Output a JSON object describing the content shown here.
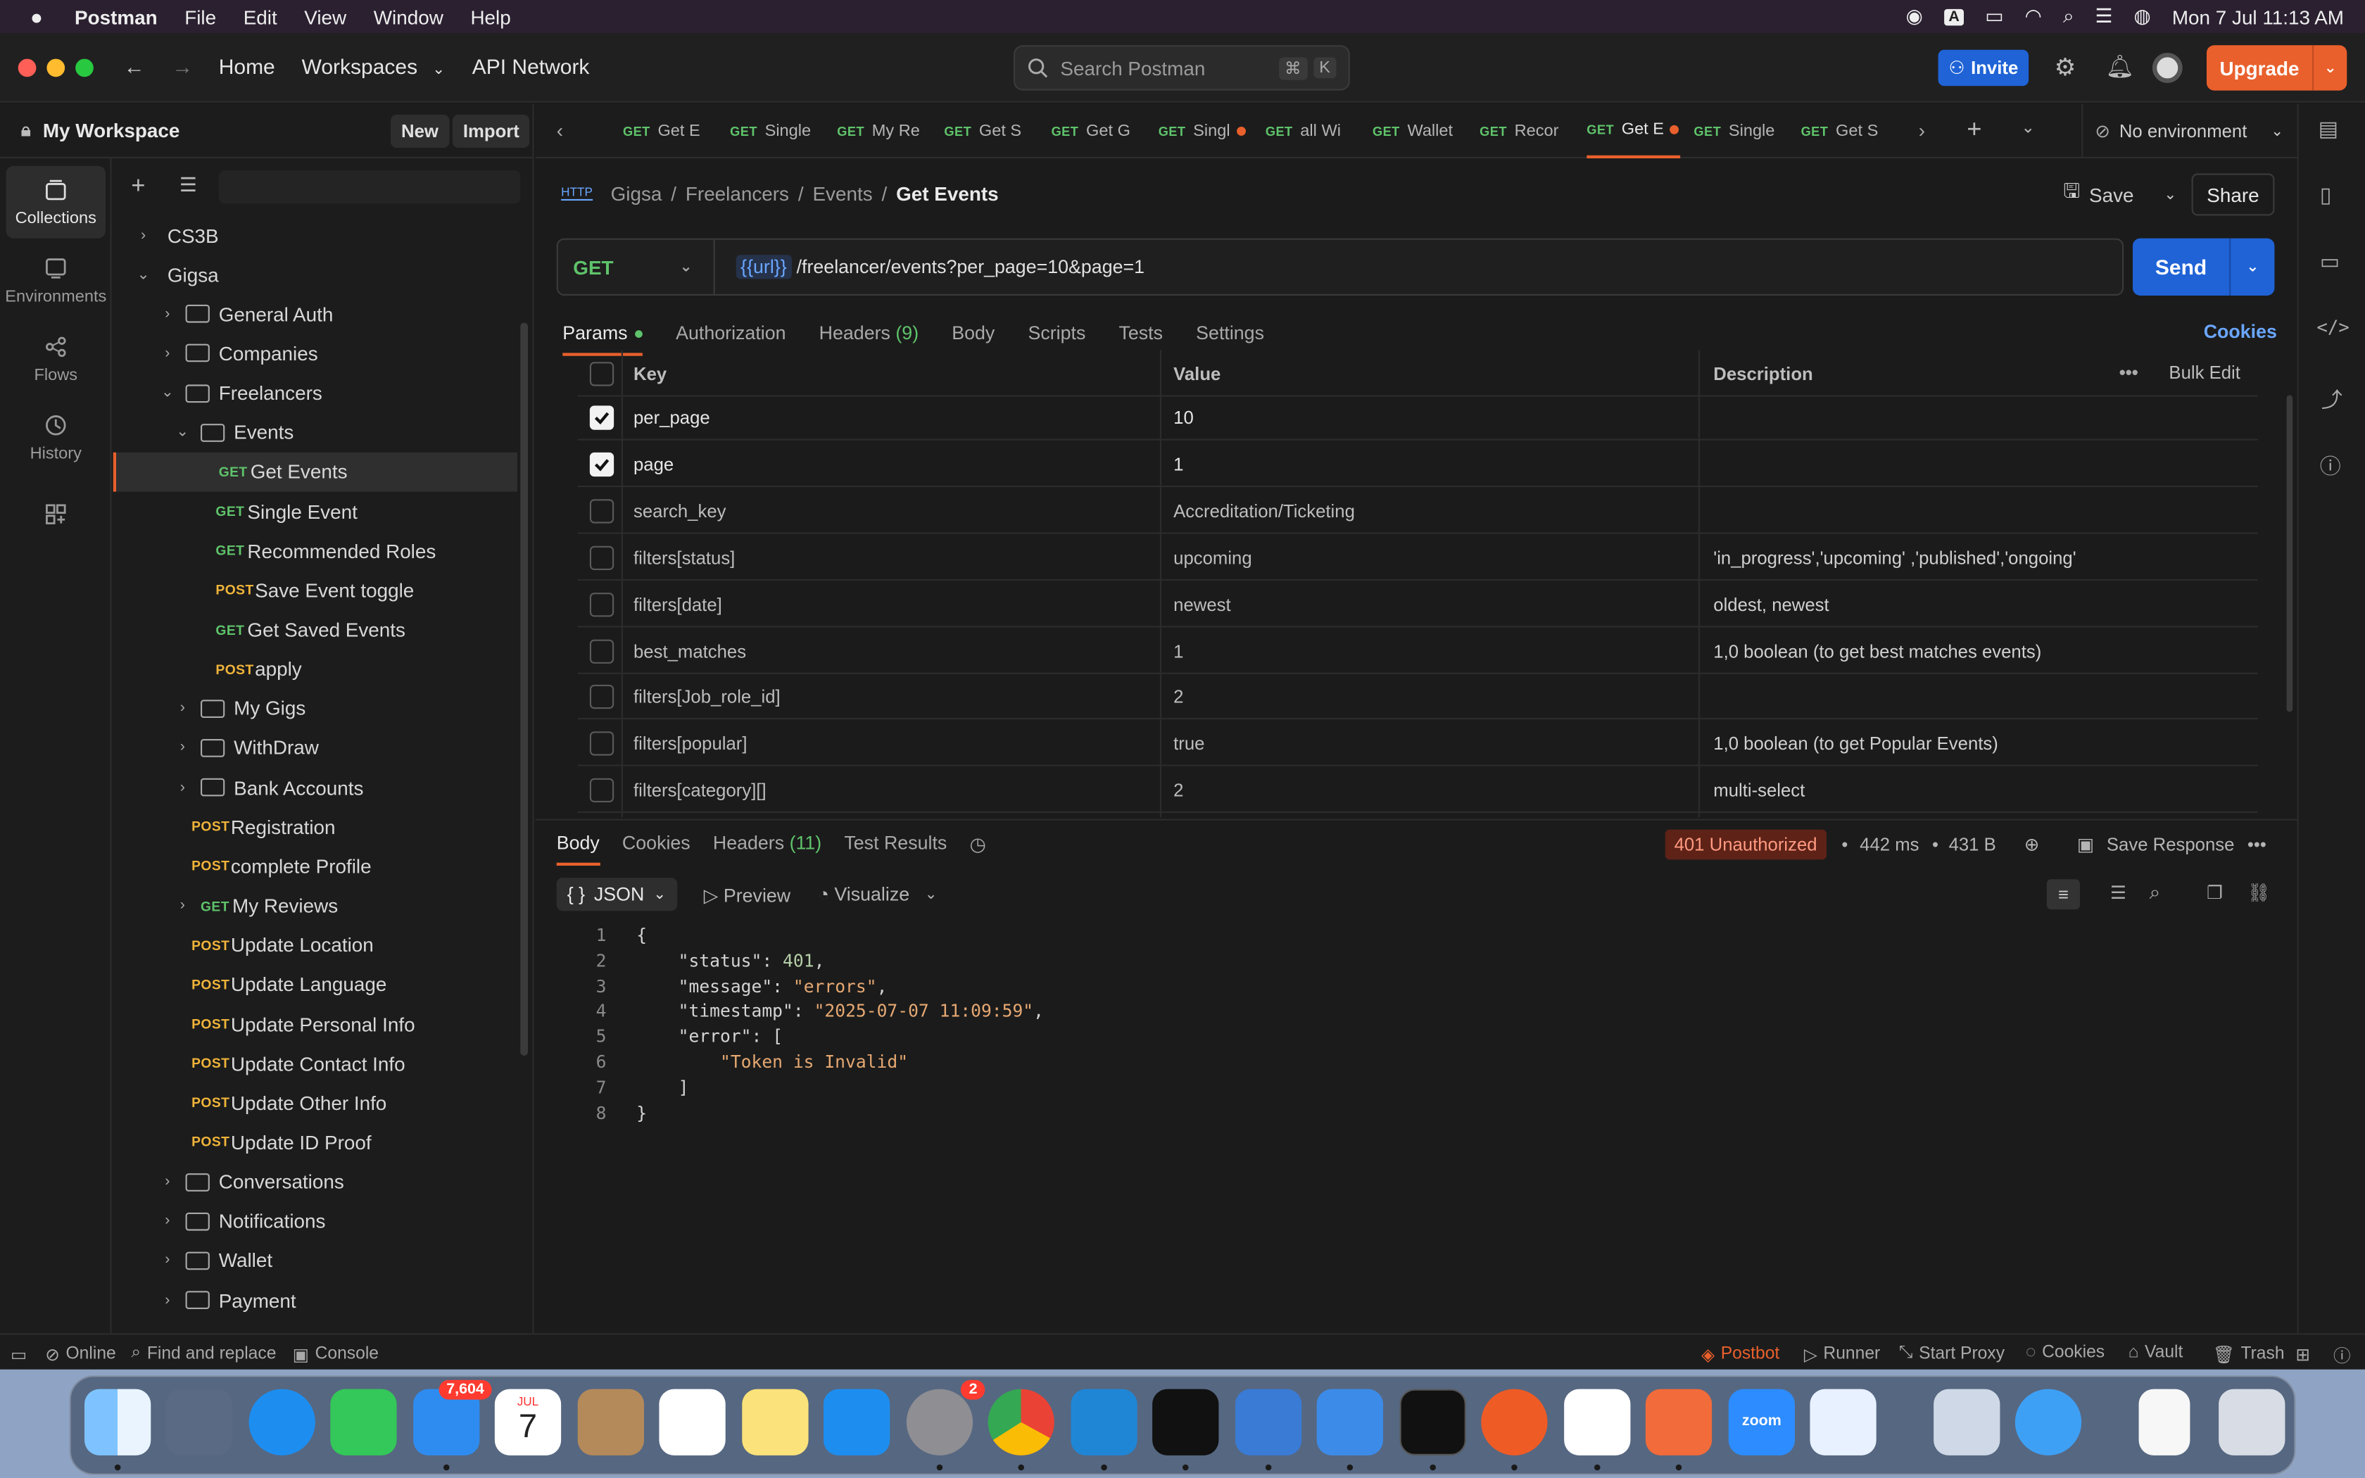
{
  "menubar": {
    "app": "Postman",
    "items": [
      "File",
      "Edit",
      "View",
      "Window",
      "Help"
    ],
    "clock": "Mon 7 Jul  11:13 AM"
  },
  "titlebar": {
    "home": "Home",
    "workspaces": "Workspaces",
    "api_network": "API Network",
    "search_placeholder": "Search Postman",
    "search_kbd_1": "⌘",
    "search_kbd_2": "K",
    "invite": "Invite",
    "upgrade": "Upgrade"
  },
  "workspace": {
    "name": "My Workspace",
    "new_label": "New",
    "import_label": "Import"
  },
  "rail": {
    "collections": "Collections",
    "environments": "Environments",
    "flows": "Flows",
    "history": "History"
  },
  "tree": [
    {
      "level": 0,
      "type": "collection",
      "label": "CS3B",
      "open": false
    },
    {
      "level": 0,
      "type": "collection",
      "label": "Gigsa",
      "open": true
    },
    {
      "level": 1,
      "type": "folder",
      "label": "General Auth",
      "open": false
    },
    {
      "level": 1,
      "type": "folder",
      "label": "Companies",
      "open": false
    },
    {
      "level": 1,
      "type": "folder",
      "label": "Freelancers",
      "open": true
    },
    {
      "level": 2,
      "type": "folder",
      "label": "Events",
      "open": true
    },
    {
      "level": 3,
      "type": "request",
      "method": "GET",
      "label": "Get Events",
      "selected": true
    },
    {
      "level": 3,
      "type": "request",
      "method": "GET",
      "label": "Single Event"
    },
    {
      "level": 3,
      "type": "request",
      "method": "GET",
      "label": "Recommended Roles"
    },
    {
      "level": 3,
      "type": "request",
      "method": "POST",
      "label": "Save Event toggle"
    },
    {
      "level": 3,
      "type": "request",
      "method": "GET",
      "label": "Get Saved Events"
    },
    {
      "level": 3,
      "type": "request",
      "method": "POST",
      "label": "apply"
    },
    {
      "level": 2,
      "type": "folder",
      "label": "My Gigs",
      "open": false
    },
    {
      "level": 2,
      "type": "folder",
      "label": "WithDraw",
      "open": false
    },
    {
      "level": 2,
      "type": "folder",
      "label": "Bank Accounts",
      "open": false
    },
    {
      "level": 2,
      "type": "request",
      "method": "POST",
      "label": "Registration"
    },
    {
      "level": 2,
      "type": "request",
      "method": "POST",
      "label": "complete Profile"
    },
    {
      "level": 2,
      "type": "reqfolder",
      "method": "GET",
      "label": "My Reviews"
    },
    {
      "level": 2,
      "type": "request",
      "method": "POST",
      "label": "Update Location"
    },
    {
      "level": 2,
      "type": "request",
      "method": "POST",
      "label": "Update Language"
    },
    {
      "level": 2,
      "type": "request",
      "method": "POST",
      "label": "Update Personal Info"
    },
    {
      "level": 2,
      "type": "request",
      "method": "POST",
      "label": "Update Contact Info"
    },
    {
      "level": 2,
      "type": "request",
      "method": "POST",
      "label": "Update Other Info"
    },
    {
      "level": 2,
      "type": "request",
      "method": "POST",
      "label": "Update ID Proof"
    },
    {
      "level": 1,
      "type": "folder",
      "label": "Conversations",
      "open": false
    },
    {
      "level": 1,
      "type": "folder",
      "label": "Notifications",
      "open": false
    },
    {
      "level": 1,
      "type": "folder",
      "label": "Wallet",
      "open": false
    },
    {
      "level": 1,
      "type": "folder",
      "label": "Payment",
      "open": false
    }
  ],
  "tabs": [
    {
      "method": "GET",
      "label": "Get E"
    },
    {
      "method": "GET",
      "label": "Single"
    },
    {
      "method": "GET",
      "label": "My Re"
    },
    {
      "method": "GET",
      "label": "Get S"
    },
    {
      "method": "GET",
      "label": "Get G"
    },
    {
      "method": "GET",
      "label": "Singl",
      "dot": true
    },
    {
      "method": "GET",
      "label": "all Wi"
    },
    {
      "method": "GET",
      "label": "Wallet"
    },
    {
      "method": "GET",
      "label": "Recor"
    },
    {
      "method": "GET",
      "label": "Get E",
      "dot": true,
      "active": true
    },
    {
      "method": "GET",
      "label": "Single"
    },
    {
      "method": "GET",
      "label": "Get S"
    }
  ],
  "environment": "No environment",
  "request": {
    "breadcrumb": [
      "Gigsa",
      "Freelancers",
      "Events"
    ],
    "name": "Get Events",
    "http_badge": "HTTP",
    "save": "Save",
    "share": "Share",
    "method": "GET",
    "url_var": "{{url}}",
    "url_path": "/freelancer/events?per_page=10&page=1",
    "send": "Send",
    "tabs": {
      "params": "Params",
      "authorization": "Authorization",
      "headers": "Headers",
      "headers_count": "(9)",
      "body": "Body",
      "scripts": "Scripts",
      "tests": "Tests",
      "settings": "Settings"
    },
    "cookies": "Cookies"
  },
  "params": {
    "headers": {
      "key": "Key",
      "value": "Value",
      "description": "Description",
      "bulk_edit": "Bulk Edit"
    },
    "rows": [
      {
        "checked": true,
        "key": "per_page",
        "value": "10",
        "description": ""
      },
      {
        "checked": true,
        "key": "page",
        "value": "1",
        "description": ""
      },
      {
        "checked": false,
        "key": "search_key",
        "value": "Accreditation/Ticketing",
        "description": ""
      },
      {
        "checked": false,
        "key": "filters[status]",
        "value": "upcoming",
        "description": "'in_progress','upcoming' ,'published','ongoing'"
      },
      {
        "checked": false,
        "key": "filters[date]",
        "value": "newest",
        "description": "oldest, newest"
      },
      {
        "checked": false,
        "key": "best_matches",
        "value": "1",
        "description": "1,0 boolean (to get best matches events)"
      },
      {
        "checked": false,
        "key": "filters[Job_role_id]",
        "value": "2",
        "description": ""
      },
      {
        "checked": false,
        "key": "filters[popular]",
        "value": "true",
        "description": "1,0 boolean (to get Popular Events)"
      },
      {
        "checked": false,
        "key": "filters[category][]",
        "value": "2",
        "description": "multi-select"
      }
    ]
  },
  "response": {
    "tabs": {
      "body": "Body",
      "cookies": "Cookies",
      "headers": "Headers",
      "headers_count": "(11)",
      "test_results": "Test Results"
    },
    "status": "401 Unauthorized",
    "time": "442 ms",
    "size": "431 B",
    "save_response": "Save Response",
    "format": "JSON",
    "format_icon": "{ }",
    "preview": "Preview",
    "visualize": "Visualize",
    "code": [
      {
        "n": "1",
        "t": "{"
      },
      {
        "n": "2",
        "k": "\"status\"",
        "v": "401",
        "vt": "num",
        "c": ","
      },
      {
        "n": "3",
        "k": "\"message\"",
        "v": "\"errors\"",
        "vt": "str",
        "c": ","
      },
      {
        "n": "4",
        "k": "\"timestamp\"",
        "v": "\"2025-07-07 11:09:59\"",
        "vt": "str",
        "c": ","
      },
      {
        "n": "5",
        "k": "\"error\"",
        "v": "[",
        "vt": "plain",
        "c": ""
      },
      {
        "n": "6",
        "v": "\"Token is Invalid\"",
        "vt": "str",
        "indent": 2
      },
      {
        "n": "7",
        "t": "]",
        "indent": 1
      },
      {
        "n": "8",
        "t": "}"
      }
    ]
  },
  "statusbar": {
    "online": "Online",
    "find_replace": "Find and replace",
    "console": "Console",
    "postbot": "Postbot",
    "runner": "Runner",
    "start_proxy": "Start Proxy",
    "cookies": "Cookies",
    "vault": "Vault",
    "trash": "Trash"
  },
  "dock": {
    "mail_badge": "7,604",
    "calendar_month": "JUL",
    "calendar_day": "7",
    "settings_badge": "2",
    "zoom_label": "zoom"
  }
}
